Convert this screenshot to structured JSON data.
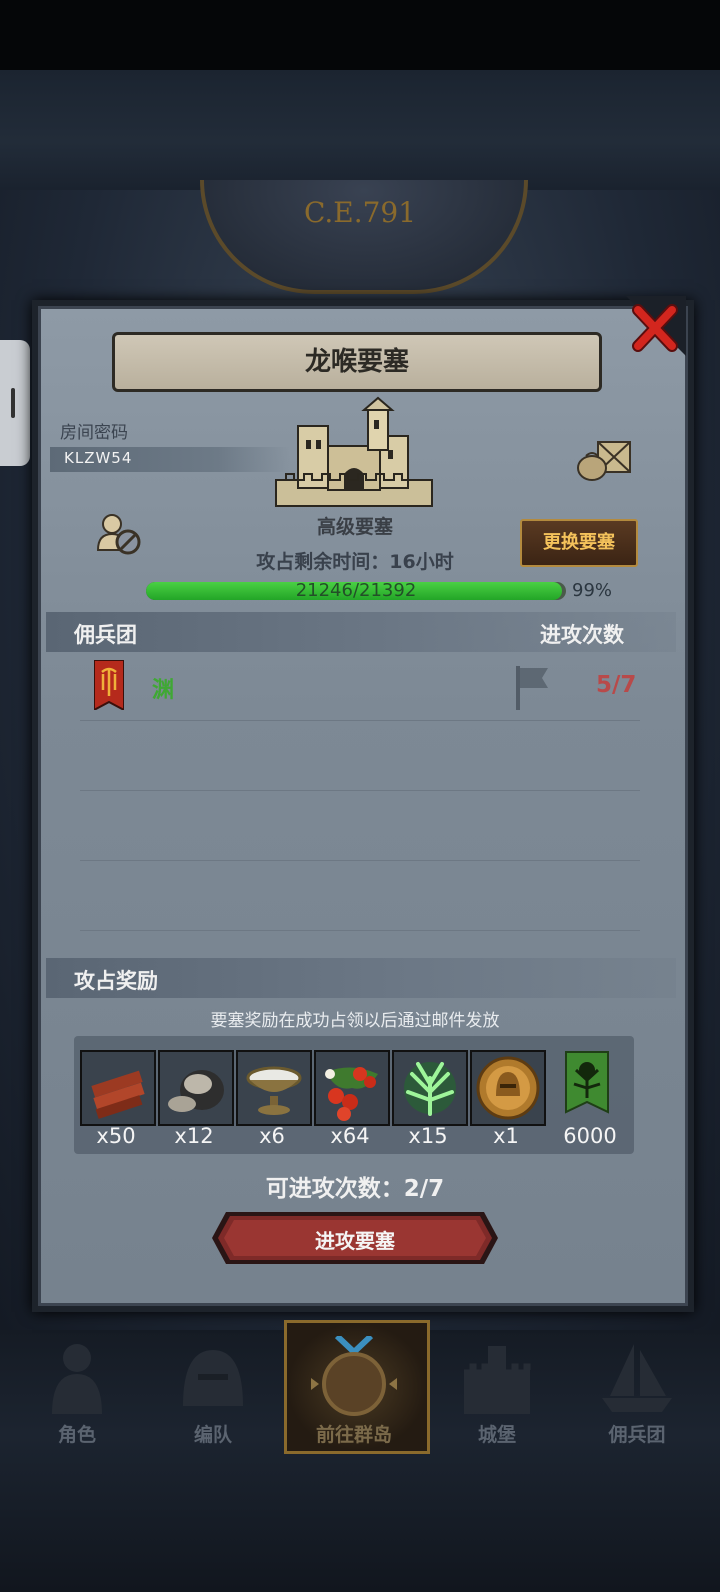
{
  "map": {
    "era": "C.E.791"
  },
  "dialog": {
    "title": "龙喉要塞",
    "room_label": "房间密码",
    "room_code": "KLZW54",
    "fortress_type": "高级要塞",
    "change_button": "更换要塞",
    "remaining_time": "攻占剩余时间：16小时",
    "progress": {
      "current": 21246,
      "max": 21392,
      "text": "21246/21392",
      "percent_text": "99%",
      "fraction": 0.99
    },
    "mercenary_section": {
      "title": "佣兵团",
      "attack_count_title": "进攻次数",
      "guilds": [
        {
          "name": "渊",
          "attacks": "5/7"
        }
      ]
    },
    "reward_section": {
      "title": "攻占奖励",
      "note": "要塞奖励在成功占领以后通过邮件发放",
      "items": [
        {
          "icon": "wood-planks-icon",
          "qty": "x50"
        },
        {
          "icon": "ore-rock-icon",
          "qty": "x12"
        },
        {
          "icon": "salt-bowl-icon",
          "qty": "x6"
        },
        {
          "icon": "berries-icon",
          "qty": "x64"
        },
        {
          "icon": "green-spirit-icon",
          "qty": "x15"
        },
        {
          "icon": "knight-helmet-coin-icon",
          "qty": "x1"
        },
        {
          "icon": "tree-banner-icon",
          "qty": "6000"
        }
      ]
    },
    "available_attacks": "可进攻次数：2/7",
    "attack_button": "进攻要塞"
  },
  "nav": {
    "items": [
      {
        "label": "角色",
        "icon": "knight-icon"
      },
      {
        "label": "编队",
        "icon": "helmet-icon"
      },
      {
        "label": "前往群岛",
        "icon": "compass-icon",
        "active": true
      },
      {
        "label": "城堡",
        "icon": "castle-icon"
      },
      {
        "label": "佣兵团",
        "icon": "ship-icon"
      }
    ]
  },
  "colors": {
    "progress_green": "#3dbd3a",
    "attack_count_red": "#b84a4a",
    "guild_green": "#3fa834",
    "change_button_text": "#f4c25b"
  }
}
